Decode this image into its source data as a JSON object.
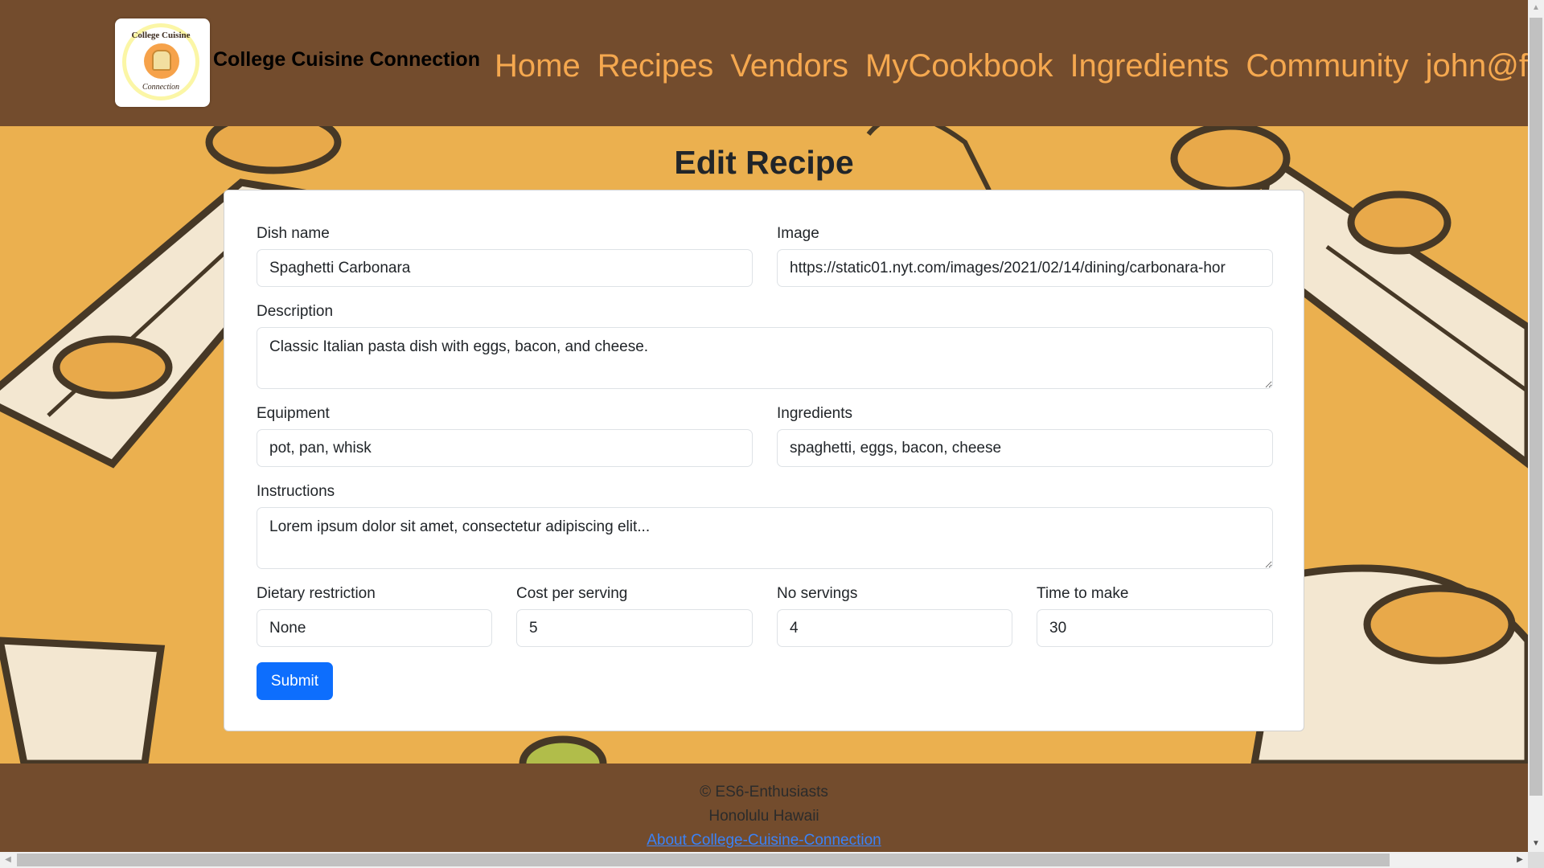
{
  "navbar": {
    "logo": {
      "top_text": "College Cuisine",
      "bottom_text": "Connection"
    },
    "brand": "College Cuisine Connection",
    "links": [
      "Home",
      "Recipes",
      "Vendors",
      "MyCookbook",
      "Ingredients",
      "Community",
      "john@foo.com"
    ]
  },
  "page": {
    "title": "Edit Recipe"
  },
  "form": {
    "dish_name": {
      "label": "Dish name",
      "value": "Spaghetti Carbonara"
    },
    "image": {
      "label": "Image",
      "value": "https://static01.nyt.com/images/2021/02/14/dining/carbonara-hor"
    },
    "description": {
      "label": "Description",
      "value": "Classic Italian pasta dish with eggs, bacon, and cheese."
    },
    "equipment": {
      "label": "Equipment",
      "value": "pot, pan, whisk"
    },
    "ingredients": {
      "label": "Ingredients",
      "value": "spaghetti, eggs, bacon, cheese"
    },
    "instructions": {
      "label": "Instructions",
      "value": "Lorem ipsum dolor sit amet, consectetur adipiscing elit..."
    },
    "dietary_restriction": {
      "label": "Dietary restriction",
      "value": "None"
    },
    "cost_per_serving": {
      "label": "Cost per serving",
      "value": "5"
    },
    "no_servings": {
      "label": "No servings",
      "value": "4"
    },
    "time_to_make": {
      "label": "Time to make",
      "value": "30"
    },
    "submit_label": "Submit"
  },
  "footer": {
    "copyright": "© ES6-Enthusiasts",
    "location": "Honolulu Hawaii",
    "about_link": "About College-Cuisine-Connection"
  },
  "colors": {
    "navbar_bg": "#734c2d",
    "nav_link": "#f5a84f",
    "background_orange": "#ebb04f",
    "submit_button": "#0d6efd",
    "footer_link": "#3b82f6"
  }
}
